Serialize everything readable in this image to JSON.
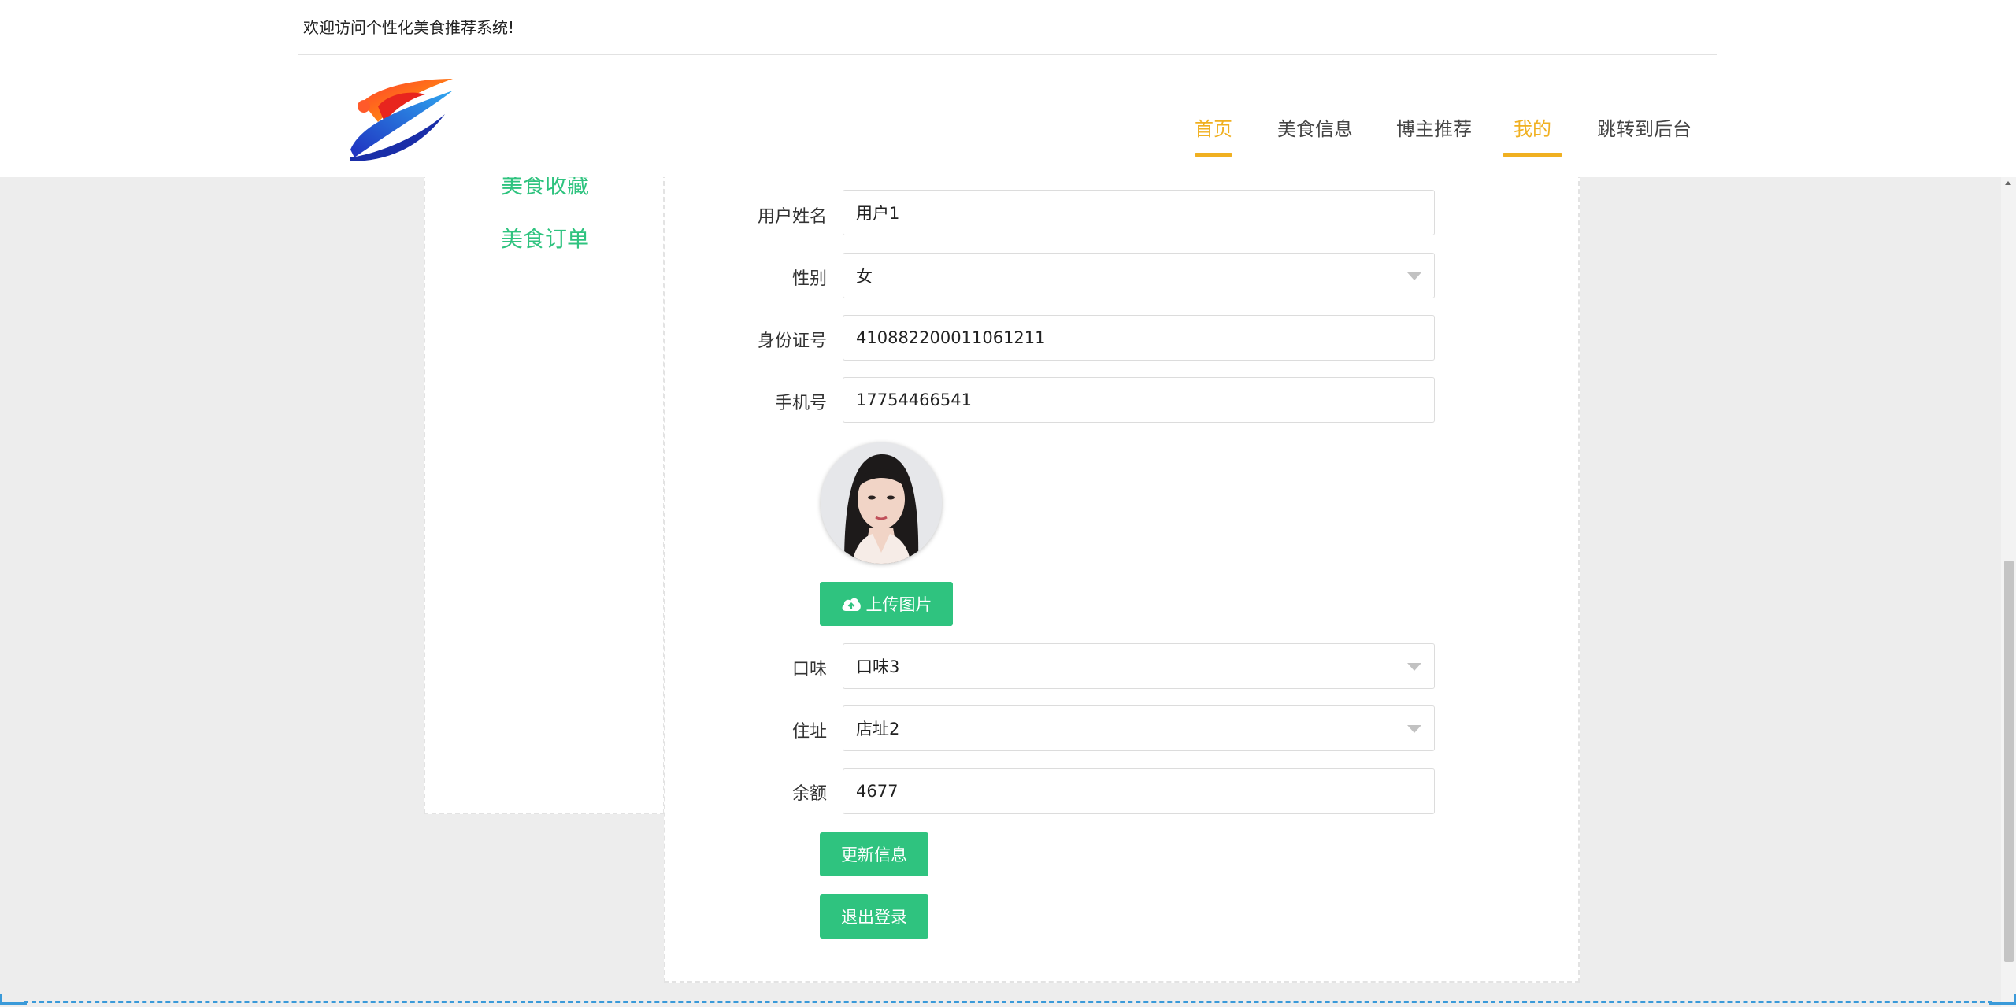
{
  "header": {
    "welcome": "欢迎访问个性化美食推荐系统!",
    "nav": [
      {
        "label": "首页",
        "active": true
      },
      {
        "label": "美食信息",
        "active": false
      },
      {
        "label": "博主推荐",
        "active": false
      },
      {
        "label": "我的",
        "active": true
      },
      {
        "label": "跳转到后台",
        "active": false
      }
    ]
  },
  "sidebar": {
    "items": [
      {
        "label": "美食收藏"
      },
      {
        "label": "美食订单"
      }
    ]
  },
  "form": {
    "username": {
      "label": "用户姓名",
      "value": "用户1"
    },
    "gender": {
      "label": "性别",
      "value": "女"
    },
    "id_number": {
      "label": "身份证号",
      "value": "410882200011061211"
    },
    "phone": {
      "label": "手机号",
      "value": "17754466541"
    },
    "upload_label": "上传图片",
    "taste": {
      "label": "口味",
      "value": "口味3"
    },
    "address": {
      "label": "住址",
      "value": "店址2"
    },
    "balance": {
      "label": "余额",
      "value": "4677"
    },
    "update_label": "更新信息",
    "logout_label": "退出登录"
  },
  "colors": {
    "accent": "#f0b021",
    "green": "#2fc37f",
    "background": "#ededed"
  },
  "icons": {
    "upload": "cloud-upload-icon",
    "select": "chevron-down-icon"
  }
}
